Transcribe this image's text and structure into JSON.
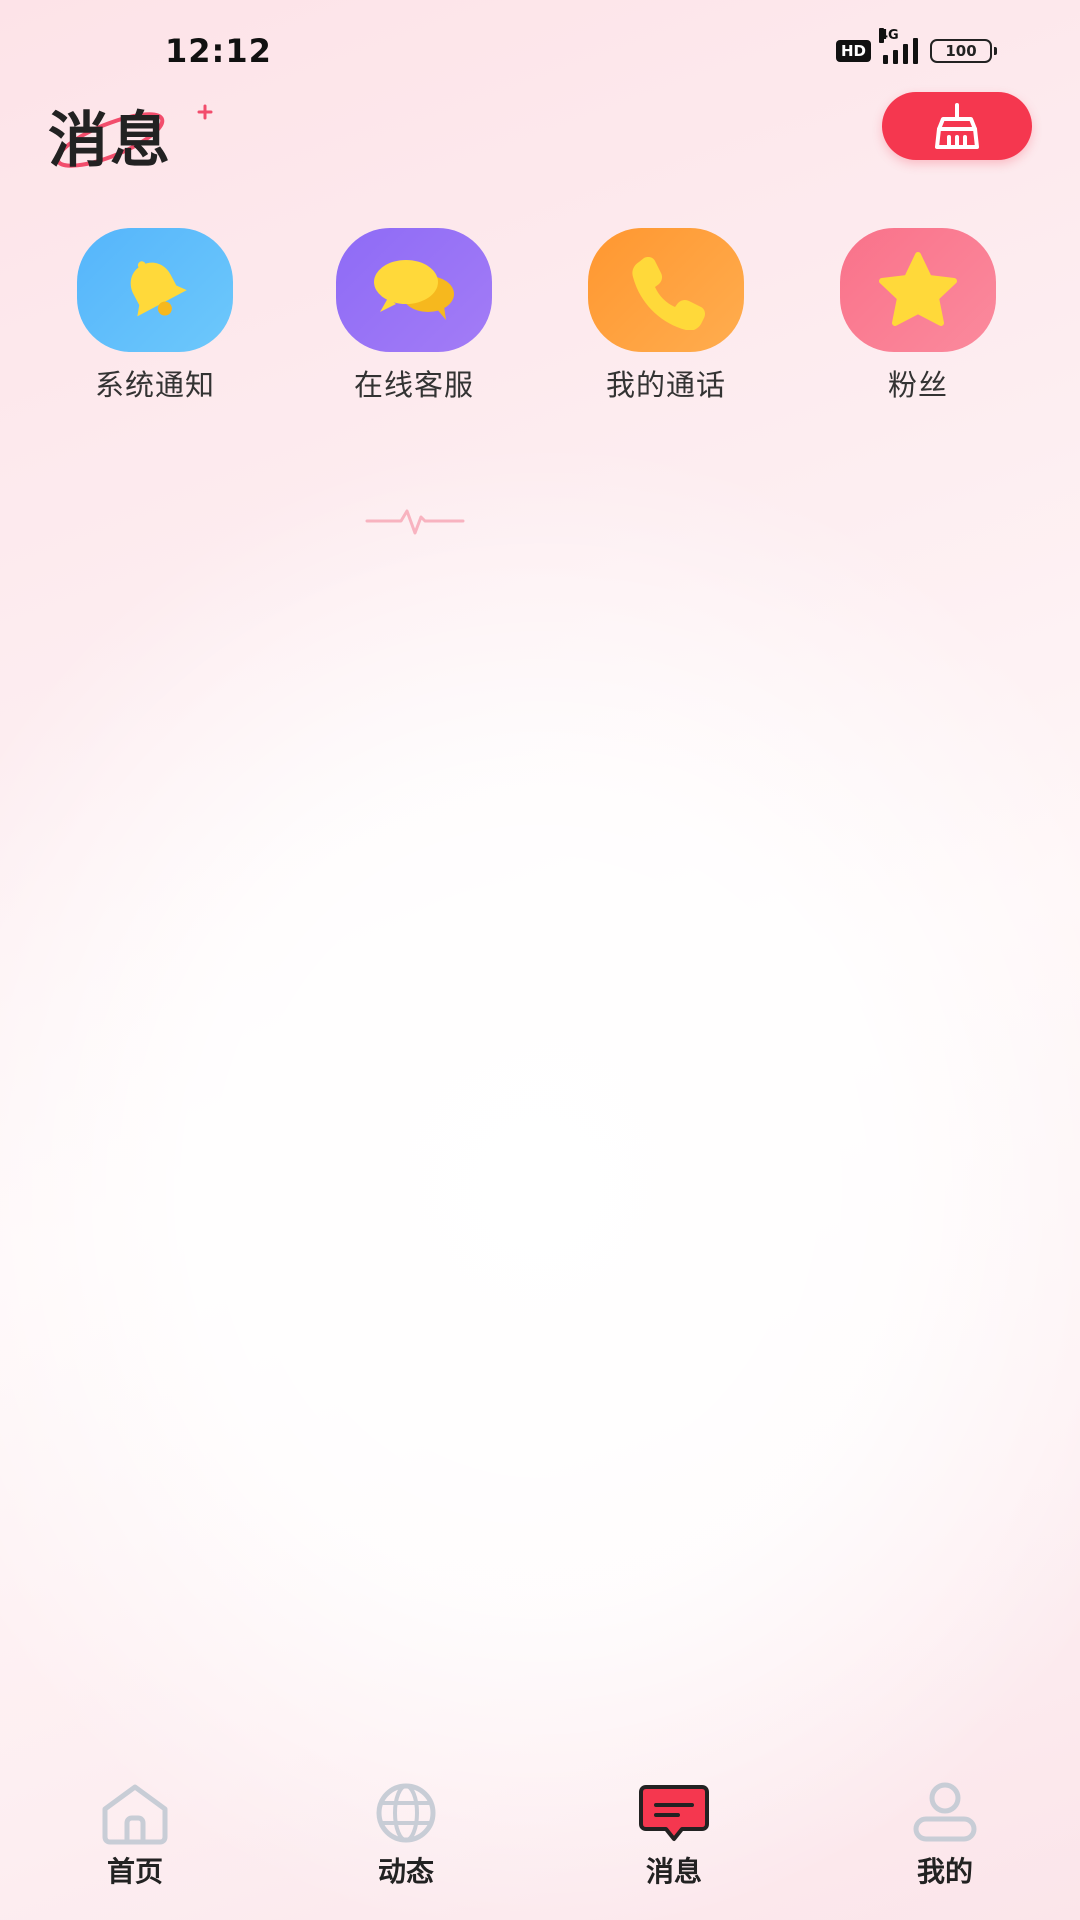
{
  "status_bar": {
    "time": "12:12",
    "hd": "HD",
    "network": "4G",
    "battery": "100"
  },
  "header": {
    "title": "消息",
    "clean_button_icon": "broom-icon"
  },
  "shortcuts": [
    {
      "label": "系统通知",
      "icon": "bell-icon",
      "color": "#5bb9fb"
    },
    {
      "label": "在线客服",
      "icon": "chat-bubbles-icon",
      "color": "#9473f6"
    },
    {
      "label": "我的通话",
      "icon": "phone-icon",
      "color": "#ff9d3b"
    },
    {
      "label": "粉丝",
      "icon": "star-icon",
      "color": "#fa7d92"
    }
  ],
  "bottom_nav": [
    {
      "label": "首页",
      "icon": "home-icon",
      "active": false
    },
    {
      "label": "动态",
      "icon": "globe-icon",
      "active": false
    },
    {
      "label": "消息",
      "icon": "message-icon",
      "active": true
    },
    {
      "label": "我的",
      "icon": "profile-icon",
      "active": false
    }
  ],
  "colors": {
    "accent": "#f5374f",
    "icon_yellow": "#ffd93a",
    "nav_inactive": "#c8cdd6"
  }
}
